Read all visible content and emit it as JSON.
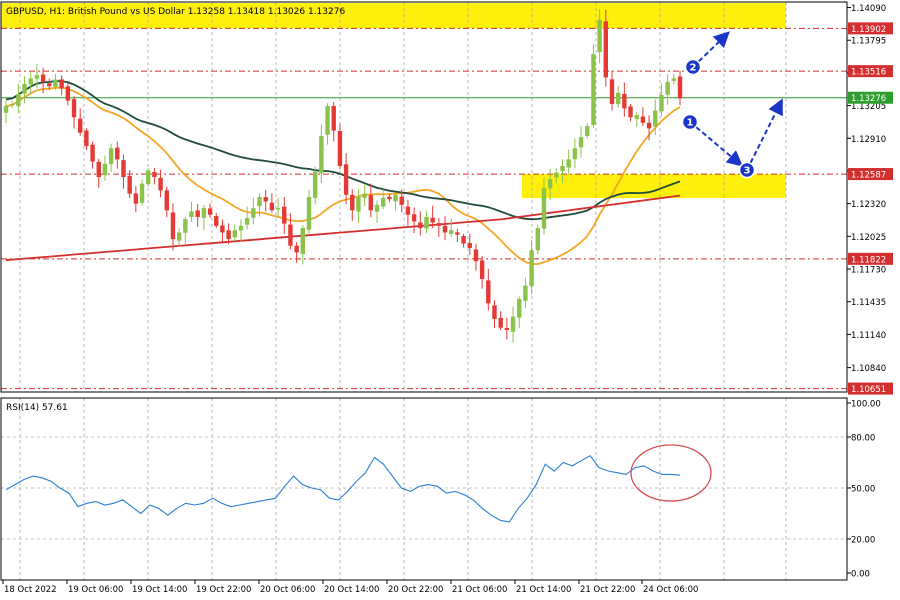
{
  "header": {
    "title": "GBPUSD, H1:  British Pound vs US Dollar  1.13258 1.13418 1.13026 1.13276"
  },
  "rsi_header": {
    "title": "RSI(14) 57.61"
  },
  "colors": {
    "bull": "#8bc34a",
    "bear": "#e53935",
    "ma_fast": "#f5a623",
    "ma_mid": "#1f4d3a",
    "ma_slow": "#d32f2f",
    "zone": "#ffee00",
    "level_line": "#d32f2f",
    "current_line": "#2e9e2e",
    "rsi": "#2a7fd4",
    "arrow": "#1a35c8"
  },
  "markers": [
    "1",
    "2",
    "3"
  ],
  "price_axis": {
    "ticks": [
      "1.14090",
      "1.13795",
      "1.13500",
      "1.13205",
      "1.12910",
      "1.12615",
      "1.12320",
      "1.12025",
      "1.11730",
      "1.11435",
      "1.11140",
      "1.10840"
    ],
    "levels": [
      {
        "price": 1.13902,
        "label": "1.13902"
      },
      {
        "price": 1.13516,
        "label": "1.13516"
      },
      {
        "price": 1.12587,
        "label": "1.12587"
      },
      {
        "price": 1.11822,
        "label": "1.11822"
      },
      {
        "price": 1.10651,
        "label": "1.10651"
      }
    ],
    "current": {
      "price": 1.13276,
      "label": "1.13276"
    }
  },
  "zones": [
    {
      "from": 1.13902,
      "to": 1.1413
    },
    {
      "from": 1.1237,
      "to": 1.12587
    }
  ],
  "rsi_axis": {
    "ticks": [
      "100.00",
      "80.00",
      "50.00",
      "20.00",
      "0.00"
    ]
  },
  "time_axis": {
    "labels": [
      "18 Oct 2022",
      "19 Oct 06:00",
      "19 Oct 14:00",
      "19 Oct 22:00",
      "20 Oct 06:00",
      "20 Oct 14:00",
      "20 Oct 22:00",
      "21 Oct 06:00",
      "21 Oct 14:00",
      "21 Oct 22:00",
      "24 Oct 06:00"
    ]
  },
  "chart_data": {
    "type": "candlestick",
    "symbol": "GBPUSD",
    "timeframe": "H1",
    "ylim": [
      1.1062,
      1.1414
    ],
    "closes": [
      1.132,
      1.1322,
      1.1331,
      1.134,
      1.1345,
      1.1348,
      1.1342,
      1.1338,
      1.1344,
      1.1336,
      1.1325,
      1.131,
      1.1296,
      1.1284,
      1.127,
      1.1256,
      1.1268,
      1.1282,
      1.1272,
      1.1256,
      1.1241,
      1.1232,
      1.125,
      1.1262,
      1.1256,
      1.1244,
      1.1226,
      1.12,
      1.1206,
      1.1218,
      1.1225,
      1.122,
      1.1228,
      1.1222,
      1.1212,
      1.1206,
      1.12,
      1.1208,
      1.1212,
      1.1219,
      1.1228,
      1.1238,
      1.1234,
      1.1226,
      1.1228,
      1.1214,
      1.1194,
      1.1188,
      1.121,
      1.1238,
      1.1261,
      1.1293,
      1.132,
      1.1298,
      1.1266,
      1.124,
      1.1226,
      1.1238,
      1.1241,
      1.1226,
      1.1231,
      1.1237,
      1.1236,
      1.124,
      1.1231,
      1.1222,
      1.1216,
      1.121,
      1.122,
      1.1215,
      1.1212,
      1.1206,
      1.1208,
      1.1204,
      1.1196,
      1.1192,
      1.118,
      1.1164,
      1.1142,
      1.1128,
      1.112,
      1.1118,
      1.113,
      1.1146,
      1.1158,
      1.119,
      1.121,
      1.1246,
      1.1254,
      1.126,
      1.1266,
      1.1272,
      1.1282,
      1.1292,
      1.1302,
      1.1367,
      1.1398,
      1.1346,
      1.1322,
      1.1332,
      1.1318,
      1.131,
      1.1312,
      1.1305,
      1.13,
      1.1316,
      1.133,
      1.1342,
      1.1345,
      1.1327
    ],
    "rsi": {
      "name": "RSI(14)",
      "values": [
        49,
        52,
        55,
        57,
        56,
        54,
        50,
        47,
        39,
        41,
        42,
        40,
        41,
        43,
        39,
        35,
        40,
        38,
        34,
        38,
        41,
        40,
        41,
        44,
        41,
        39,
        40,
        41,
        42,
        43,
        44,
        51,
        57,
        52,
        50,
        49,
        44,
        43,
        48,
        54,
        59,
        68,
        64,
        57,
        50,
        48,
        51,
        52,
        51,
        47,
        48,
        46,
        43,
        38,
        34,
        31,
        30,
        38,
        44,
        52,
        64,
        60,
        65,
        63,
        66,
        69,
        62,
        60,
        59,
        58,
        62,
        63,
        60,
        58,
        58,
        57.61
      ],
      "ylim": [
        0,
        100
      ]
    },
    "xlabel": "",
    "ylabel": ""
  }
}
